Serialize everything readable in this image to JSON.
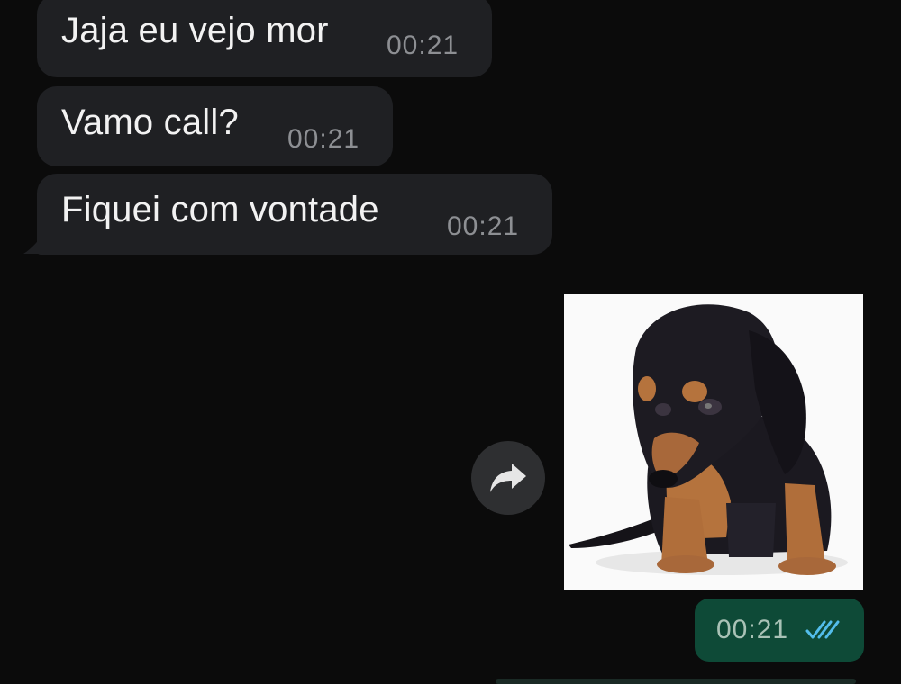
{
  "messages_in": [
    {
      "text": "Jaja eu vejo mor",
      "time": "00:21"
    },
    {
      "text": "Vamo call?",
      "time": "00:21"
    },
    {
      "text": "Fiquei com vontade",
      "time": "00:21"
    }
  ],
  "message_out": {
    "time": "00:21",
    "status": "read",
    "media": "puppy-photo"
  },
  "icons": {
    "forward": "forward-icon",
    "read_receipt": "double-check-icon"
  },
  "colors": {
    "background": "#0b0b0b",
    "incoming_bubble": "#1f2023",
    "outgoing_bubble": "#0e4a37",
    "read_tick": "#53bdeb",
    "timestamp_in": "#8d8f93"
  }
}
